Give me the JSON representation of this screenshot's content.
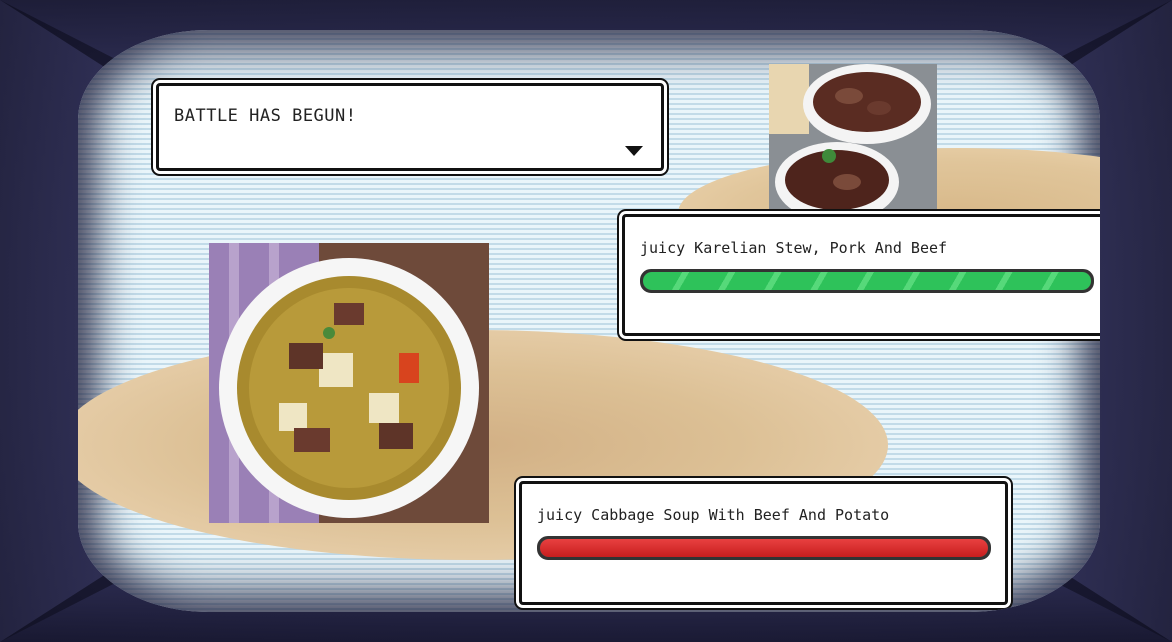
{
  "message": {
    "text": "BATTLE HAS BEGUN!",
    "advance_icon": "triangle-down-icon"
  },
  "enemy": {
    "name": "juicy Karelian Stew, Pork And Beef",
    "hp_fraction": 1.0,
    "hp_color": "#2ec25a",
    "image_name": "karelian-stew-image"
  },
  "player": {
    "name": "juicy Cabbage Soup With Beef And Potato",
    "hp_fraction": 1.0,
    "hp_color": "#d92a2a",
    "image_name": "cabbage-soup-image"
  }
}
